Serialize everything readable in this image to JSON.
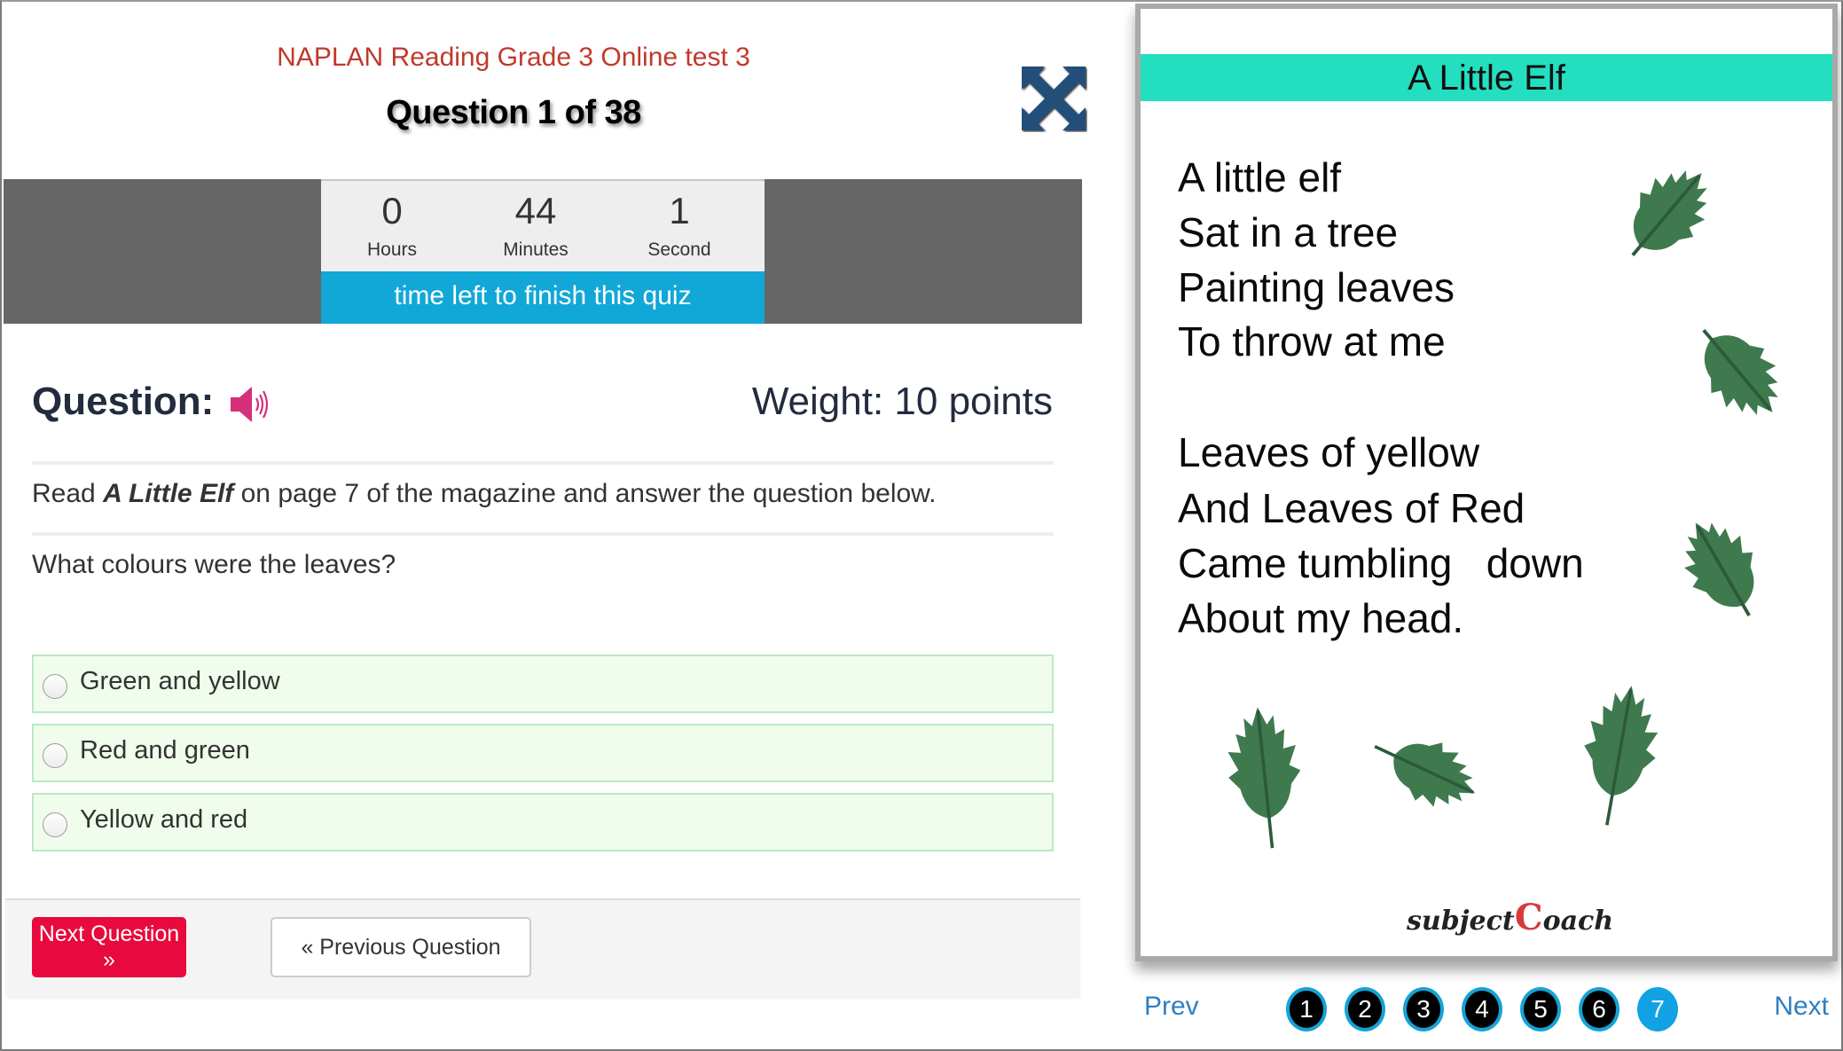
{
  "header": {
    "quiz_title": "NAPLAN Reading Grade 3 Online test 3",
    "question_counter": "Question 1 of 38",
    "expand_icon": "expand-arrows-icon"
  },
  "timer": {
    "hours": "0",
    "hours_label": "Hours",
    "minutes": "44",
    "minutes_label": "Minutes",
    "seconds": "1",
    "seconds_label": "Second",
    "caption": "time left to finish this quiz"
  },
  "question": {
    "heading": "Question:",
    "audio_icon": "speaker-icon",
    "weight": "Weight: 10 points",
    "instruction_pre": "Read ",
    "instruction_title": "A Little Elf",
    "instruction_post": " on page 7 of the magazine and answer the question below.",
    "prompt": "What colours were the leaves?",
    "options": [
      {
        "label": "Green and yellow",
        "selected": false
      },
      {
        "label": "Red and green",
        "selected": false
      },
      {
        "label": "Yellow and red",
        "selected": false
      }
    ]
  },
  "footer": {
    "next_label": "Next Question »",
    "prev_label": "« Previous Question"
  },
  "magazine": {
    "title": "A Little Elf",
    "stanza1": [
      "A little elf",
      "Sat in a tree",
      "Painting leaves",
      "To throw at me"
    ],
    "stanza2": [
      "Leaves of yellow",
      "And Leaves of Red",
      "Came tumbling   down",
      "About my head."
    ],
    "logo_text_a": "subject",
    "logo_text_b": "oach",
    "logo_c": "C",
    "colors": {
      "title_band": "#23dfc0",
      "leaf": "#3f7a4f",
      "logo_red": "#d63a3a"
    }
  },
  "pager": {
    "prev_label": "Prev",
    "next_label": "Next",
    "pages": [
      "1",
      "2",
      "3",
      "4",
      "5",
      "6",
      "7"
    ],
    "current_page": "7"
  },
  "colors": {
    "title_red": "#c0392b",
    "timer_blue": "#11a7d6",
    "next_button": "#e8093d",
    "option_bg": "#f0fdec",
    "speaker_pink": "#d6307b",
    "expand_blue": "#24507a"
  }
}
